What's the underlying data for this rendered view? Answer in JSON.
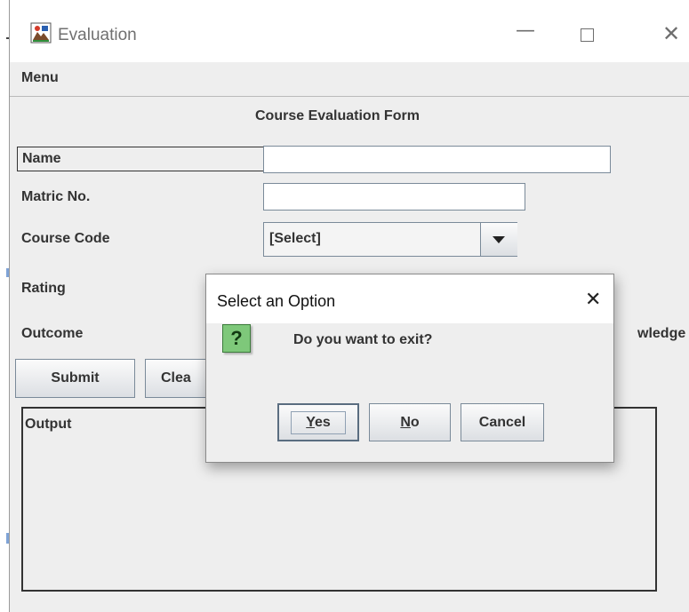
{
  "window": {
    "title": "Evaluation",
    "menu_label": "Menu"
  },
  "form": {
    "heading": "Course Evaluation Form",
    "name_label": "Name",
    "name_value": "",
    "matric_label": "Matric No.",
    "matric_value": "",
    "course_code_label": "Course Code",
    "course_code_selected": "[Select]",
    "rating_label": "Rating",
    "outcome_label": "Outcome",
    "outcome_partial_text": "wledge",
    "submit_label": "Submit",
    "clear_label_partial": "Clea",
    "output_label": "Output"
  },
  "dialog": {
    "title": "Select an Option",
    "question_glyph": "?",
    "message": "Do you want to exit?",
    "yes_mnemonic": "Y",
    "yes_rest": "es",
    "no_mnemonic": "N",
    "no_rest": "o",
    "cancel_label": "Cancel"
  },
  "colors": {
    "window_bg": "#eeeeee",
    "question_icon_bg": "#7ec87a",
    "button_border": "#7a8a99"
  },
  "icons": {
    "app_icon": "java-cup-icon",
    "minimize": "minimize-icon",
    "maximize": "maximize-icon",
    "close": "close-icon",
    "dropdown": "chevron-down-icon"
  }
}
